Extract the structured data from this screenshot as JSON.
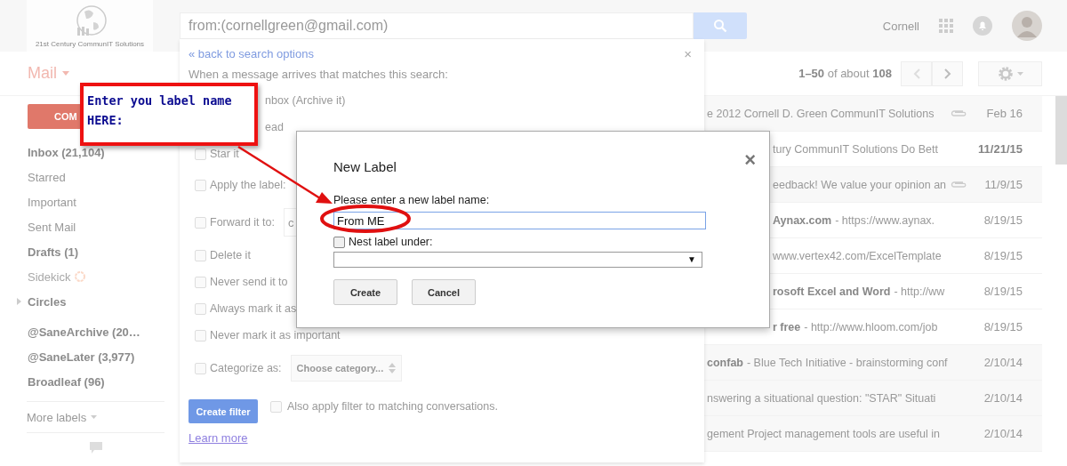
{
  "header": {
    "logo_caption": "21st Century CommunIT Solutions",
    "search": {
      "value": "from:(cornellgreen@gmail.com)"
    },
    "account_name": "Cornell"
  },
  "toolbar": {
    "mail_menu": "Mail",
    "page_info": "**1–50** of about **108**"
  },
  "sidebar": {
    "compose": "COM",
    "items": [
      {
        "label": "Inbox (21,104)",
        "bold": true,
        "kind": "label"
      },
      {
        "label": "Starred",
        "bold": false,
        "kind": "label"
      },
      {
        "label": "Important",
        "bold": false,
        "kind": "label"
      },
      {
        "label": "Sent Mail",
        "bold": false,
        "kind": "label"
      },
      {
        "label": "Drafts (1)",
        "bold": true,
        "kind": "label"
      },
      {
        "label": "Sidekick",
        "bold": false,
        "kind": "sidekick"
      },
      {
        "label": "Circles",
        "bold": true,
        "kind": "circles"
      }
    ],
    "labels": [
      {
        "label": "@SaneArchive (20…",
        "bold": true
      },
      {
        "label": "@SaneLater (3,977)",
        "bold": true
      },
      {
        "label": "Broadleaf (96)",
        "bold": true
      }
    ],
    "more_labels": "More labels"
  },
  "filter_panel": {
    "back_link": "« back to search options",
    "close": "×",
    "intro": "When a message arrives that matches this search:",
    "options": [
      {
        "kind": "partial",
        "label": "nbox (Archive it)"
      },
      {
        "kind": "partial",
        "label": "ead"
      },
      {
        "kind": "check",
        "label": "Star it",
        "checked": false
      },
      {
        "kind": "labelpick",
        "label": "Apply the label:",
        "checked": false
      },
      {
        "kind": "field",
        "label": "Forward it to:",
        "checked": false,
        "value": "c"
      },
      {
        "kind": "check",
        "label": "Delete it",
        "checked": false
      },
      {
        "kind": "check",
        "label": "Never send it to",
        "checked": false
      },
      {
        "kind": "check",
        "label": "Always mark it as",
        "checked": false
      },
      {
        "kind": "check",
        "label": "Never mark it as important",
        "checked": false
      },
      {
        "kind": "select",
        "label": "Categorize as:",
        "checked": false,
        "value": "Choose category..."
      }
    ],
    "create_button": "Create filter",
    "apply_existing": {
      "label": "Also apply filter to matching conversations.",
      "checked": false
    },
    "learn_more": "Learn more"
  },
  "emails": [
    {
      "snippet": "e 2012 Cornell D. Green CommunIT Solutions",
      "attachment": true,
      "date": "Feb 16",
      "read": true,
      "unread": false
    },
    {
      "snippet": "tury CommunIT Solutions Do Bett",
      "attachment": false,
      "date": "11/21/15",
      "read": false,
      "unread": true
    },
    {
      "snippet": "eedback! We value your opinion an",
      "attachment": true,
      "date": "11/9/15",
      "read": true,
      "unread": false
    },
    {
      "subject": "Aynax.com",
      "snippet": "- https://www.aynax.",
      "attachment": false,
      "date": "8/19/15",
      "read": false,
      "unread": false
    },
    {
      "snippet": "www.vertex42.com/ExcelTemplate",
      "attachment": false,
      "date": "8/19/15",
      "read": false,
      "unread": false
    },
    {
      "subject": "rosoft Excel and Word",
      "snippet": "- http://ww",
      "attachment": false,
      "date": "8/19/15",
      "read": false,
      "unread": false
    },
    {
      "subject": "r free",
      "snippet": "- http://www.hloom.com/job",
      "attachment": false,
      "date": "8/19/15",
      "read": false,
      "unread": false
    },
    {
      "subject": "confab",
      "snippet": "- Blue Tech Initiative - brainstorming conf",
      "attachment": false,
      "date": "2/10/14",
      "read": true,
      "unread": false
    },
    {
      "snippet": "nswering a situational question: \"STAR\" Situati",
      "attachment": false,
      "date": "2/10/14",
      "read": true,
      "unread": false
    },
    {
      "snippet": "gement Project management tools are useful in",
      "attachment": false,
      "date": "2/10/14",
      "read": true,
      "unread": false
    }
  ],
  "dialog": {
    "title": "New Label",
    "close": "×",
    "prompt": "Please enter a new label name:",
    "name_field": {
      "value": "From ME"
    },
    "nest": {
      "label": "Nest label under:",
      "checked": false
    },
    "parent_select": {
      "arrow": "▼"
    },
    "buttons": [
      "Create",
      "Cancel"
    ]
  },
  "callout": {
    "text": "Enter you label name HERE:"
  }
}
